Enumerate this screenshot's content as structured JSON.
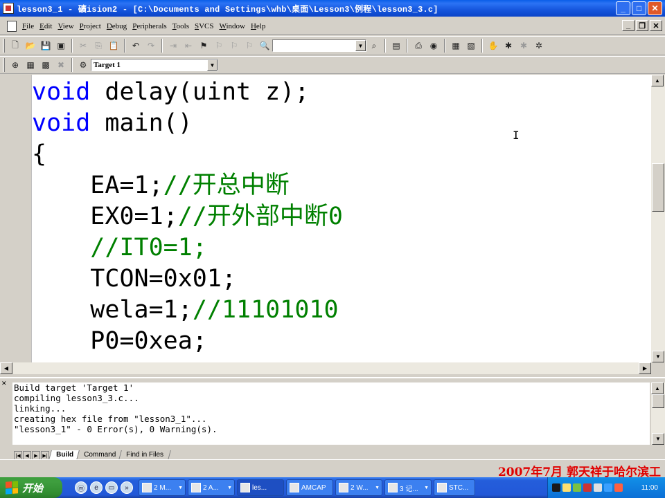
{
  "window": {
    "title": "lesson3_1  - 礦ision2 - [C:\\Documents and Settings\\whb\\桌面\\Lesson3\\例程\\lesson3_3.c]",
    "caption_buttons": [
      "minimize",
      "maximize",
      "close"
    ]
  },
  "menu": {
    "items": [
      "File",
      "Edit",
      "View",
      "Project",
      "Debug",
      "Peripherals",
      "Tools",
      "SVCS",
      "Window",
      "Help"
    ]
  },
  "toolbar": {
    "find_value": "",
    "target_value": "Target 1"
  },
  "editor": {
    "lines": [
      {
        "indent": "",
        "keyword": "void",
        "code": " delay(uint z);",
        "comment": ""
      },
      {
        "indent": "",
        "keyword": "void",
        "code": " main()",
        "comment": ""
      },
      {
        "indent": "",
        "keyword": "",
        "code": "{",
        "comment": ""
      },
      {
        "indent": "    ",
        "keyword": "",
        "code": "EA=1;",
        "comment": "//开总中断"
      },
      {
        "indent": "    ",
        "keyword": "",
        "code": "EX0=1;",
        "comment": "//开外部中断0"
      },
      {
        "indent": "    ",
        "keyword": "",
        "code": "",
        "comment": "//IT0=1;"
      },
      {
        "indent": "    ",
        "keyword": "",
        "code": "TCON=0x01;",
        "comment": ""
      },
      {
        "indent": "    ",
        "keyword": "",
        "code": "wela=1;",
        "comment": "//11101010"
      },
      {
        "indent": "    ",
        "keyword": "",
        "code": "P0=0xea;",
        "comment": ""
      }
    ]
  },
  "output": {
    "lines": [
      "Build target 'Target 1'",
      "compiling lesson3_3.c...",
      "linking...",
      "creating hex file from \"lesson3_1\"...",
      "\"lesson3_1\" - 0 Error(s), 0 Warning(s)."
    ],
    "tabs": [
      "Build",
      "Command",
      "Find in Files"
    ],
    "active_tab": "Build"
  },
  "watermark": "2007年7月  郭天祥于哈尔滨工",
  "taskbar": {
    "start_label": "开始",
    "tasks": [
      "2 M...",
      "2 A...",
      "les...",
      "AMCAP",
      "2 W...",
      "3 记...",
      "STC..."
    ],
    "clock": "11:00"
  },
  "colors": {
    "keyword": "#0000ff",
    "comment": "#008000",
    "text": "#000000",
    "watermark": "#e00000",
    "titlebar": "#0a5ee8"
  }
}
